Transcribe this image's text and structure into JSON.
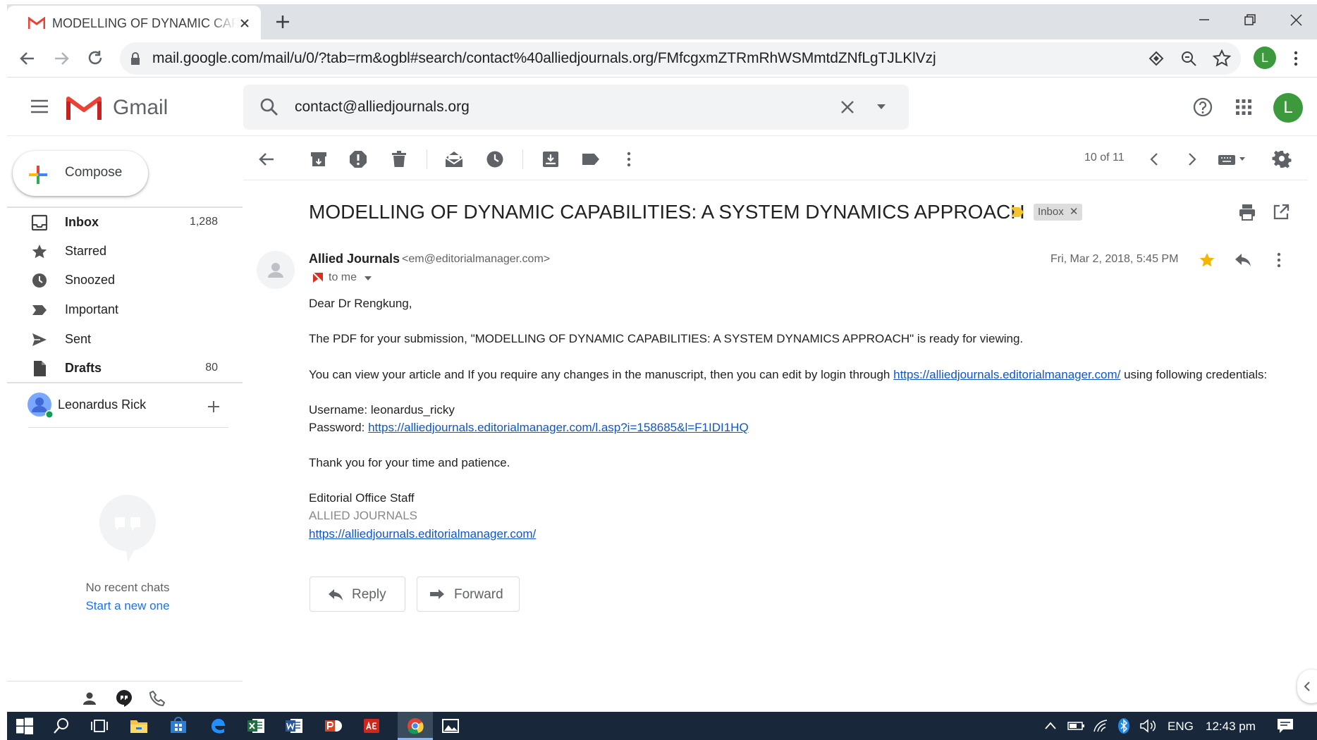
{
  "browser": {
    "tab_title": "MODELLING OF DYNAMIC CAPABILITIES: A SYSTEM DYNAMICS APPROACH",
    "url": "mail.google.com/mail/u/0/?tab=rm&ogbl#search/contact%40alliedjournals.org/FMfcgxmZTRmRhWSMmtdZNfLgTJLKlVzj",
    "profile_initial": "L"
  },
  "gmail": {
    "logo_text": "Gmail",
    "search_value": "contact@alliedjournals.org",
    "avatar_initial": "L"
  },
  "sidebar": {
    "compose_label": "Compose",
    "items": [
      {
        "label": "Inbox",
        "count": "1,288"
      },
      {
        "label": "Starred",
        "count": ""
      },
      {
        "label": "Snoozed",
        "count": ""
      },
      {
        "label": "Important",
        "count": ""
      },
      {
        "label": "Sent",
        "count": ""
      },
      {
        "label": "Drafts",
        "count": "80"
      }
    ],
    "user_name": "Leonardus Rick",
    "no_chats": "No recent chats",
    "start_new": "Start a new one"
  },
  "toolbar": {
    "pager": "10 of 11"
  },
  "email": {
    "subject": "MODELLING OF DYNAMIC CAPABILITIES: A SYSTEM DYNAMICS APPROACH",
    "label": "Inbox",
    "sender_name": "Allied Journals",
    "sender_email": "<em@editorialmanager.com>",
    "to": "to me",
    "date": "Fri, Mar 2, 2018, 5:45 PM",
    "greeting": "Dear Dr Rengkung,",
    "para1": "The PDF for your submission, \"MODELLING OF DYNAMIC CAPABILITIES: A SYSTEM DYNAMICS APPROACH\" is ready for viewing.",
    "para2_before": "You can view your article and If you require any changes in the manuscript, then you can edit by login through ",
    "para2_link": "https://alliedjournals.editorialmanager.com/",
    "para2_after": " using following credentials:",
    "username_line": "Username: leonardus_ricky",
    "password_prefix": "Password: ",
    "password_link": "https://alliedjournals.editorialmanager.com/l.asp?i=158685&l=F1IDI1HQ",
    "thanks": "Thank you for your time and patience.",
    "sig1": "Editorial Office Staff",
    "sig2": "ALLIED JOURNALS",
    "sig_link": "https://alliedjournals.editorialmanager.com/",
    "reply_label": "Reply",
    "forward_label": "Forward"
  },
  "taskbar": {
    "language": "ENG",
    "time": "12:43 pm"
  },
  "colors": {
    "gmail_red": "#ea4335",
    "avatar_green": "#3c9a3c",
    "link_blue": "#1155cc",
    "taskbar": "#18283a",
    "star_yellow": "#f4b400"
  }
}
